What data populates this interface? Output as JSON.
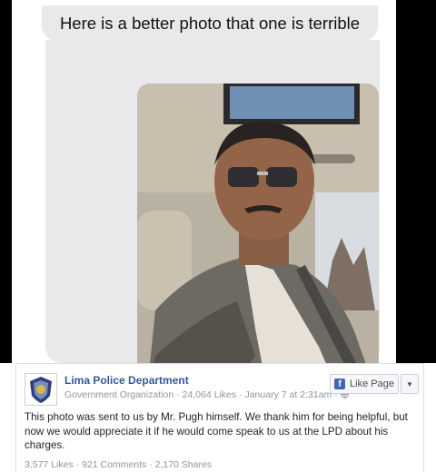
{
  "message": {
    "bubble_text": "Here is a better photo that one is terrible"
  },
  "post": {
    "page_name": "Lima Police Department",
    "category": "Government Organization",
    "likes": "24,064 Likes",
    "date": "January 7 at 2:31am",
    "like_button_label": "Like Page",
    "body": "This photo was sent to us by Mr. Pugh himself. We thank him for being helpful, but now we would appreciate it if he would come speak to us at the LPD about his charges.",
    "reaction_likes": "3,577 Likes",
    "comments": "921 Comments",
    "shares": "2,170 Shares"
  },
  "colors": {
    "link_blue": "#365899",
    "facebook_blue": "#4267b2",
    "bubble_gray": "#e9e9eb"
  },
  "icons": [
    "facebook-logo-icon",
    "dropdown-arrow-icon",
    "globe-icon",
    "police-badge-avatar"
  ]
}
